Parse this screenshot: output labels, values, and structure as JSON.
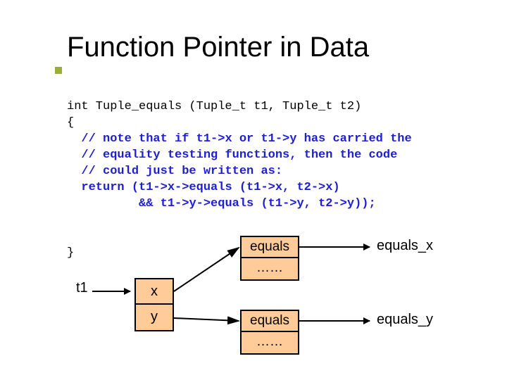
{
  "title": "Function Pointer in Data",
  "code": "int Tuple_equals (Tuple_t t1, Tuple_t t2)\n{\n  <span class=\"blue\">// note that if t1->x or t1->y has carried the</span>\n  <span class=\"blue\">// equality testing functions, then the code</span>\n  <span class=\"blue\">// could just be written as:</span>\n  <span class=\"blue\">return (t1->x->equals (t1->x, t2->x)</span>\n          <span class=\"blue\">&& t1->y->equals (t1->y, t2->y));</span>",
  "closing_brace": "}",
  "ptr": {
    "label": "t1"
  },
  "tuple": {
    "x": "x",
    "y": "y"
  },
  "struct_top": {
    "field1": "equals",
    "field2": "……"
  },
  "struct_bot": {
    "field1": "equals",
    "field2": "……"
  },
  "right_labels": {
    "top": "equals_x",
    "bottom": "equals_y"
  }
}
